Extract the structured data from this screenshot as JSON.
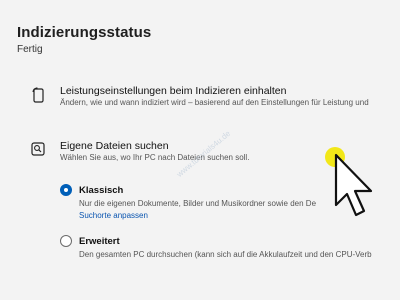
{
  "header": {
    "title": "Indizierungsstatus",
    "status": "Fertig"
  },
  "performance": {
    "title": "Leistungseinstellungen beim Indizieren einhalten",
    "description": "Ändern, wie und wann indiziert wird – basierend auf den Einstellungen für Leistung und",
    "icon": "power-phone-icon"
  },
  "search_files": {
    "title": "Eigene Dateien suchen",
    "description": "Wählen Sie aus, wo Ihr PC nach Dateien suchen soll.",
    "icon": "search-folder-icon",
    "options": [
      {
        "label": "Klassisch",
        "description": "Nur die eigenen Dokumente, Bilder und Musikordner sowie den De",
        "link": "Suchorte anpassen",
        "selected": true
      },
      {
        "label": "Erweitert",
        "description": "Den gesamten PC durchsuchen (kann sich auf die Akkulaufzeit und den CPU-Verb",
        "selected": false
      }
    ]
  },
  "colors": {
    "accent": "#005fb8",
    "cursor_highlight": "#f2e600"
  }
}
